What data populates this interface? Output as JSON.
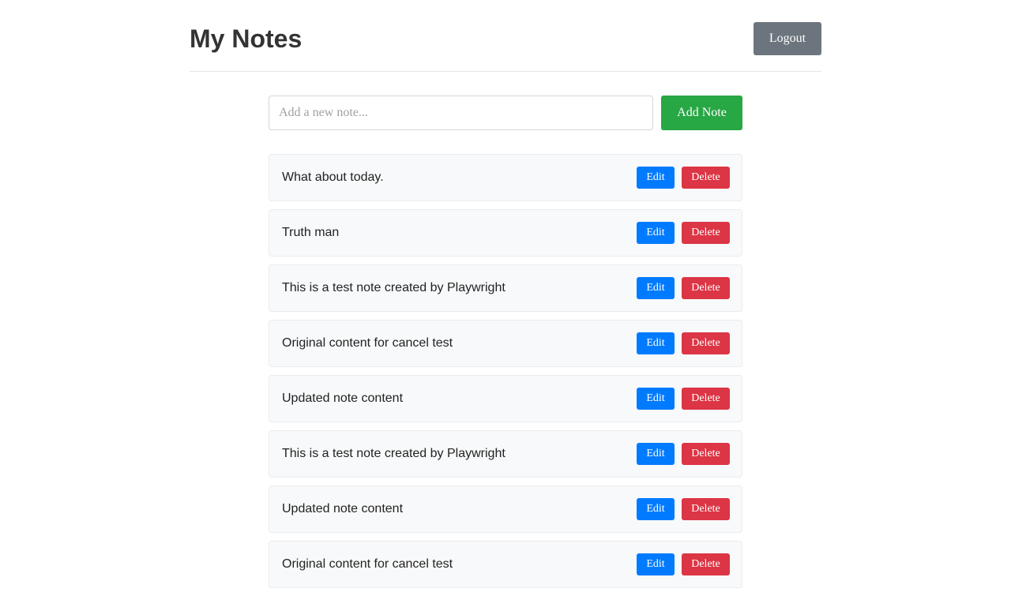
{
  "header": {
    "title": "My Notes",
    "logout_label": "Logout"
  },
  "add_form": {
    "placeholder": "Add a new note...",
    "value": "",
    "add_label": "Add Note"
  },
  "notes": [
    {
      "text": "What about today.",
      "edit_label": "Edit",
      "delete_label": "Delete"
    },
    {
      "text": "Truth man",
      "edit_label": "Edit",
      "delete_label": "Delete"
    },
    {
      "text": "This is a test note created by Playwright",
      "edit_label": "Edit",
      "delete_label": "Delete"
    },
    {
      "text": "Original content for cancel test",
      "edit_label": "Edit",
      "delete_label": "Delete"
    },
    {
      "text": "Updated note content",
      "edit_label": "Edit",
      "delete_label": "Delete"
    },
    {
      "text": "This is a test note created by Playwright",
      "edit_label": "Edit",
      "delete_label": "Delete"
    },
    {
      "text": "Updated note content",
      "edit_label": "Edit",
      "delete_label": "Delete"
    },
    {
      "text": "Original content for cancel test",
      "edit_label": "Edit",
      "delete_label": "Delete"
    }
  ],
  "colors": {
    "logout": "#6c757d",
    "add": "#28a745",
    "edit": "#007bff",
    "delete": "#dc3545",
    "note_background": "#f8f9fa"
  }
}
